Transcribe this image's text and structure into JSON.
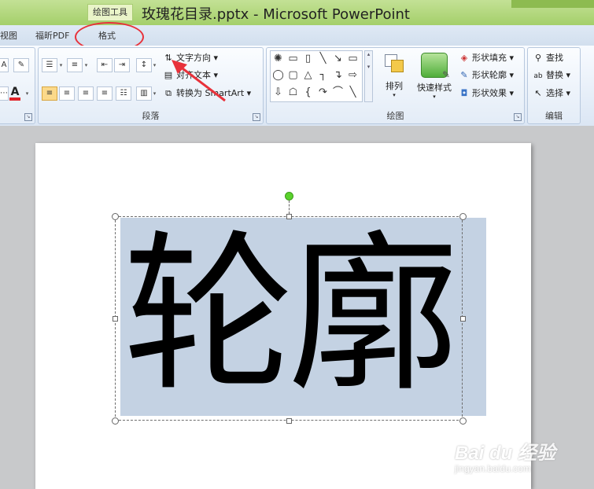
{
  "titlebar": {
    "context_tool": "绘图工具",
    "document_title": "玫瑰花目录.pptx - Microsoft PowerPoint"
  },
  "tabs": {
    "view_partial": "视图",
    "foxit_pdf": "福昕PDF",
    "format": "格式"
  },
  "ribbon": {
    "paragraph": {
      "group_label": "段落",
      "text_direction": "文字方向",
      "align_text": "对齐文本",
      "convert_smartart": "转换为 SmartArt"
    },
    "drawing": {
      "group_label": "绘图",
      "arrange": "排列",
      "quick_styles": "快速样式",
      "shape_fill": "形状填充",
      "shape_outline": "形状轮廓",
      "shape_effects": "形状效果"
    },
    "editing": {
      "group_label": "编辑",
      "find": "查找",
      "replace": "替换",
      "select": "选择"
    }
  },
  "slide": {
    "text": "轮廓"
  },
  "watermark": {
    "logo": "Bai du 经验",
    "url": "jingyan.baidu.com"
  },
  "colors": {
    "title_bar": "#a4cf6a",
    "selection_fill": "#c4d2e3",
    "annotation_red": "#e8313a",
    "rotate_handle": "#5ad22c"
  }
}
